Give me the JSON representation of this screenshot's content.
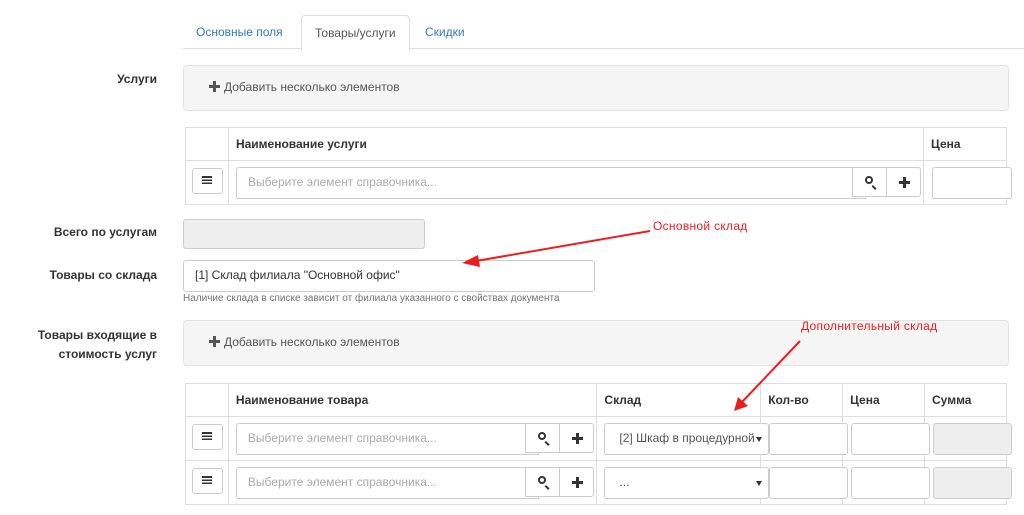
{
  "tabs": [
    {
      "label": "Основные поля"
    },
    {
      "label": "Товары/услуги"
    },
    {
      "label": "Скидки"
    }
  ],
  "services": {
    "label": "Услуги",
    "add_label": "Добавить несколько элементов",
    "columns": [
      "Наименование услуги",
      "Цена"
    ],
    "row_placeholder": "Выберите элемент справочника..."
  },
  "services_total": {
    "label": "Всего по услугам",
    "value": ""
  },
  "warehouse": {
    "label": "Товары со склада",
    "value": "[1] Склад филиала \"Основной офис\"",
    "help": "Наличие склада в списке зависит от филиала указанного с свойствах документа"
  },
  "goods": {
    "label": "Товары входящие в стоимость услуг",
    "add_label": "Добавить несколько элементов",
    "columns": [
      "Наименование товара",
      "Склад",
      "Кол-во",
      "Цена",
      "Сумма"
    ],
    "rows": [
      {
        "placeholder": "Выберите элемент справочника...",
        "warehouse": "[2] Шкаф в процедурной"
      },
      {
        "placeholder": "Выберите элемент справочника...",
        "warehouse": "..."
      }
    ]
  },
  "annotations": {
    "main": "Основной склад",
    "extra": "Дополнительный склад",
    "color": "#ee1c1c"
  },
  "icons": [
    "plus-icon",
    "drag-handle-icon",
    "search-icon",
    "caret-down-icon",
    "arrow-annotation"
  ]
}
